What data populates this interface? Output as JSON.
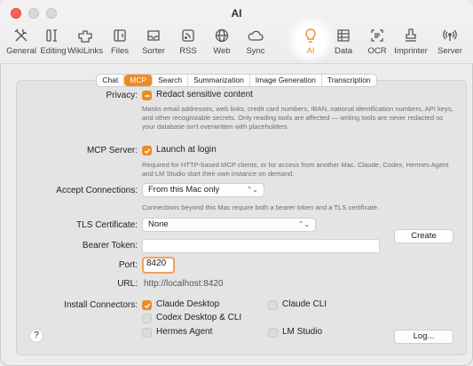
{
  "window": {
    "title": "AI"
  },
  "toolbar": {
    "items": [
      {
        "label": "General",
        "icon": "tools-icon"
      },
      {
        "label": "Editing",
        "icon": "editing-icon"
      },
      {
        "label": "WikiLinks",
        "icon": "wikilinks-icon"
      },
      {
        "label": "Files",
        "icon": "files-icon"
      },
      {
        "label": "Sorter",
        "icon": "sorter-icon"
      },
      {
        "label": "RSS",
        "icon": "rss-icon"
      },
      {
        "label": "Web",
        "icon": "globe-icon"
      },
      {
        "label": "Sync",
        "icon": "cloud-icon"
      },
      {
        "label": "AI",
        "icon": "lightbulb-icon"
      },
      {
        "label": "Data",
        "icon": "data-icon"
      },
      {
        "label": "OCR",
        "icon": "ocr-icon"
      },
      {
        "label": "Imprinter",
        "icon": "imprinter-icon"
      },
      {
        "label": "Server",
        "icon": "server-icon"
      }
    ],
    "active": "AI",
    "accent": "#f08b22"
  },
  "tabs": [
    "Chat",
    "MCP",
    "Search",
    "Summarization",
    "Image Generation",
    "Transcription"
  ],
  "active_tab": "MCP",
  "privacy": {
    "label": "Privacy:",
    "option": "Redact sensitive content",
    "description": "Masks email addresses, web links, credit card numbers, IBAN, national identification numbers, API keys, and other recognizable secrets. Only reading tools are affected — writing tools are never redacted so your database isn't overwritten with placeholders."
  },
  "mcp_server": {
    "label": "MCP Server:",
    "option": "Launch at login",
    "description": "Required for HTTP-based MCP clients, or for access from another Mac. Claude, Codex, Hermes Agent and LM Studio start their own instance on demand."
  },
  "accept": {
    "label": "Accept Connections:",
    "value": "From this Mac only",
    "description": "Connections beyond this Mac require both a bearer token and a TLS certificate."
  },
  "tls": {
    "label": "TLS Certificate:",
    "value": "None",
    "create_button": "Create"
  },
  "bearer": {
    "label": "Bearer Token:",
    "value": ""
  },
  "port": {
    "label": "Port:",
    "value": "8420"
  },
  "url": {
    "label": "URL:",
    "value": "http://localhost:8420"
  },
  "connectors": {
    "label": "Install Connectors:",
    "items": [
      {
        "name": "Claude Desktop",
        "checked": true
      },
      {
        "name": "Claude CLI",
        "checked": false
      },
      {
        "name": "Codex Desktop & CLI",
        "checked": false
      },
      {
        "name": "Hermes Agent",
        "checked": false
      },
      {
        "name": "LM Studio",
        "checked": false
      }
    ]
  },
  "footer": {
    "help": "?",
    "log_button": "Log..."
  }
}
